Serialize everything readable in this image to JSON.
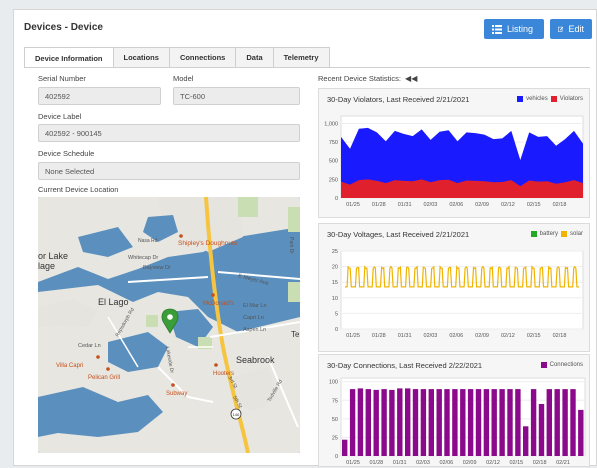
{
  "header": {
    "title": "Devices - Device",
    "listing_label": "Listing",
    "edit_label": "Edit"
  },
  "tabs": [
    {
      "label": "Device Information",
      "active": true
    },
    {
      "label": "Locations"
    },
    {
      "label": "Connections"
    },
    {
      "label": "Data"
    },
    {
      "label": "Telemetry"
    }
  ],
  "fields": {
    "serial_label": "Serial Number",
    "serial_value": "402592",
    "model_label": "Model",
    "model_value": "TC-600",
    "device_label_label": "Device Label",
    "device_label_value": "402592 - 900145",
    "schedule_label": "Device Schedule",
    "schedule_value": "None Selected",
    "location_label": "Current Device Location"
  },
  "map": {
    "labels": [
      "Shipley's Doughnuts",
      "Whitecap Dr",
      "Bayview Dr",
      "E Meyer Ave",
      "El Lago",
      "or Lake",
      "lage",
      "McDonald's",
      "El Mar Ln",
      "Capri Ln",
      "Aspen Ln",
      "Cedar Ln",
      "Villa Capri",
      "Pelican Grill",
      "Hooters",
      "Subway",
      "Seabrook",
      "Park Dr",
      "Te",
      "146",
      "3rd St",
      "5th St",
      "Todville Rd",
      "Lakeside Dr",
      "Repsdorph Rd",
      "Nasa Rd"
    ]
  },
  "stats": {
    "title": "Recent Device Statistics:"
  },
  "chart_data": [
    {
      "type": "area",
      "title": "30-Day Violators, Last Received 2/21/2021",
      "legend": "top-right",
      "series": [
        {
          "name": "vehicles",
          "color": "#1a1aff",
          "values": [
            820,
            660,
            930,
            940,
            880,
            760,
            900,
            860,
            830,
            920,
            780,
            890,
            910,
            760,
            880,
            870,
            850,
            790,
            800,
            900,
            510,
            880,
            820,
            830,
            700,
            790,
            900,
            730
          ]
        },
        {
          "name": "Violators",
          "color": "#e0202c",
          "values": [
            220,
            180,
            240,
            250,
            230,
            200,
            240,
            230,
            225,
            250,
            210,
            240,
            245,
            200,
            235,
            230,
            225,
            210,
            215,
            240,
            160,
            235,
            220,
            225,
            190,
            210,
            240,
            200
          ]
        }
      ],
      "x_ticks": [
        "01/25",
        "01/28",
        "01/31",
        "02/03",
        "02/06",
        "02/09",
        "02/12",
        "02/15",
        "02/18"
      ],
      "y_ticks": [
        0,
        250,
        500,
        750,
        "1,000"
      ],
      "ylim": [
        0,
        1100
      ]
    },
    {
      "type": "line",
      "title": "30-Day Voltages, Last Received 2/21/2021",
      "legend": "top-right",
      "series": [
        {
          "name": "battery",
          "color": "#22aa22",
          "values": []
        },
        {
          "name": "solar",
          "color": "#f0b400",
          "min": 13.5,
          "max": 20
        }
      ],
      "x_ticks": [
        "01/25",
        "01/28",
        "01/31",
        "02/03",
        "02/06",
        "02/09",
        "02/12",
        "02/15",
        "02/18"
      ],
      "y_ticks": [
        0,
        5,
        10,
        15,
        20,
        25
      ],
      "ylim": [
        0,
        25
      ]
    },
    {
      "type": "bar",
      "title": "30-Day Connections, Last Received 2/22/2021",
      "legend": "top-right",
      "series": [
        {
          "name": "Connections",
          "color": "#8b0a8b",
          "values": [
            22,
            90,
            91,
            90,
            89,
            90,
            89,
            91,
            91,
            90,
            90,
            90,
            90,
            90,
            90,
            90,
            90,
            90,
            90,
            90,
            90,
            90,
            90,
            40,
            90,
            70,
            90,
            90,
            90,
            90,
            62
          ]
        }
      ],
      "x_ticks": [
        "01/25",
        "01/28",
        "01/31",
        "02/03",
        "02/06",
        "02/09",
        "02/12",
        "02/15",
        "02/18",
        "02/21"
      ],
      "y_ticks": [
        0,
        25,
        50,
        75,
        100
      ],
      "ylim": [
        0,
        105
      ]
    }
  ]
}
